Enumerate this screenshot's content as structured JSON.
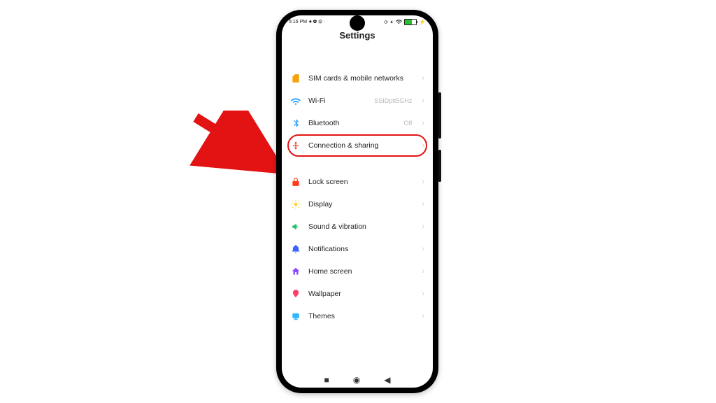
{
  "status_bar": {
    "time": "5:16 PM",
    "left_icons": "⏺ ✿ ⚙ ·",
    "right_icons": "⟳ ✦"
  },
  "header": {
    "title": "Settings"
  },
  "groups": [
    {
      "items": [
        {
          "icon": "sim",
          "color": "#f6a20b",
          "label": "SIM cards & mobile networks",
          "value": ""
        },
        {
          "icon": "wifi",
          "color": "#1f9bff",
          "label": "Wi-Fi",
          "value": "SSIDptt5GHz"
        },
        {
          "icon": "bluetooth",
          "color": "#1f9bff",
          "label": "Bluetooth",
          "value": "Off"
        },
        {
          "icon": "share",
          "color": "#e53b2b",
          "label": "Connection & sharing",
          "value": "",
          "highlight": true
        }
      ]
    },
    {
      "items": [
        {
          "icon": "lock",
          "color": "#ff3d1a",
          "label": "Lock screen",
          "value": ""
        },
        {
          "icon": "sun",
          "color": "#ffcc33",
          "label": "Display",
          "value": ""
        },
        {
          "icon": "sound",
          "color": "#18c26b",
          "label": "Sound & vibration",
          "value": ""
        },
        {
          "icon": "bell",
          "color": "#3a62ff",
          "label": "Notifications",
          "value": ""
        },
        {
          "icon": "home",
          "color": "#8b4bff",
          "label": "Home screen",
          "value": ""
        },
        {
          "icon": "wall",
          "color": "#ff3d6b",
          "label": "Wallpaper",
          "value": ""
        },
        {
          "icon": "theme",
          "color": "#2fb6ff",
          "label": "Themes",
          "value": ""
        }
      ]
    }
  ],
  "nav": {
    "recent": "■",
    "home": "◉",
    "back": "◀"
  },
  "annotation": {
    "arrow_color": "#e31313"
  }
}
